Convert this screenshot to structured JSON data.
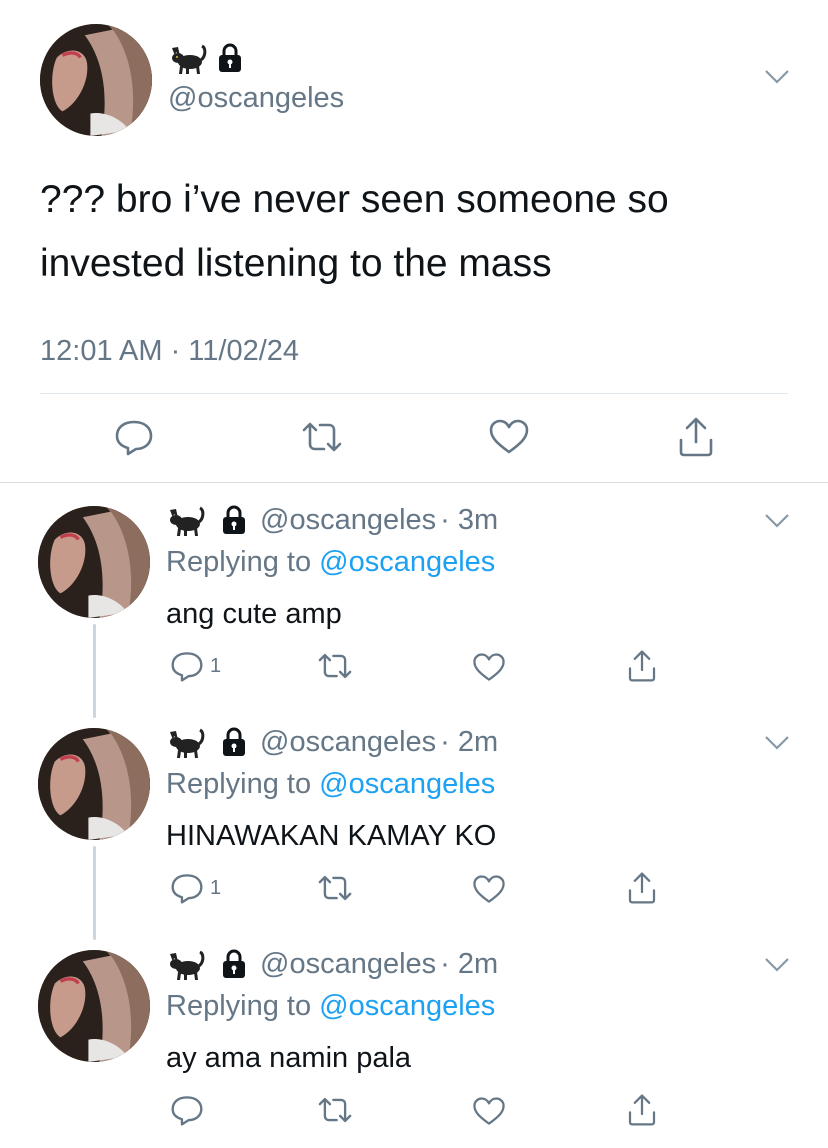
{
  "main_tweet": {
    "handle": "@oscangeles",
    "text_line1": "??? bro i’ve never seen someone so",
    "text_line2": "invested listening to the mass",
    "timestamp": "12:01 AM · 11/02/24"
  },
  "replies": [
    {
      "handle": "@oscangeles",
      "time": "· 3m",
      "replying_prefix": "Replying to",
      "replying_to": "@oscangeles",
      "text": "ang cute amp",
      "reply_count": "1"
    },
    {
      "handle": "@oscangeles",
      "time": "· 2m",
      "replying_prefix": "Replying to",
      "replying_to": "@oscangeles",
      "text": "HINAWAKAN KAMAY KO",
      "reply_count": "1"
    },
    {
      "handle": "@oscangeles",
      "time": "· 2m",
      "replying_prefix": "Replying to",
      "replying_to": "@oscangeles",
      "text": "ay ama namin pala",
      "reply_count": ""
    }
  ],
  "icons": {
    "name_emoji": "cat-icon",
    "lock": "lock-icon",
    "reply": "reply-icon",
    "retweet": "retweet-icon",
    "like": "heart-icon",
    "share": "share-icon",
    "menu": "chevron-down-icon"
  },
  "colors": {
    "text": "#0f1419",
    "secondary": "#657786",
    "link": "#1da1f2",
    "divider": "#e1e8ed",
    "icon": "#657786"
  }
}
